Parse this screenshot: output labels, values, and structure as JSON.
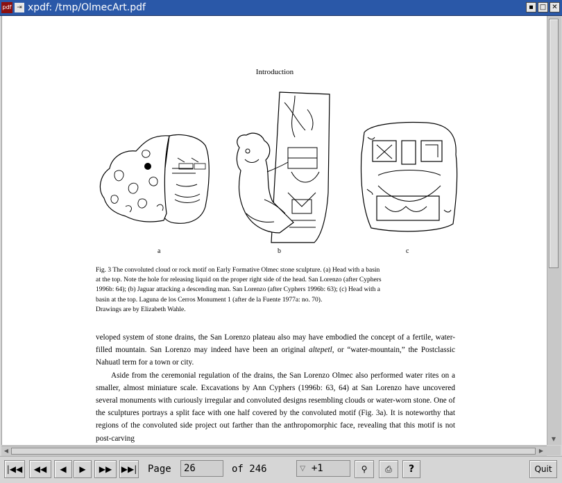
{
  "window": {
    "title": "xpdf: /tmp/OlmecArt.pdf",
    "app_icon_label": "pdf",
    "buttons": [
      "iconify",
      "maximize",
      "close"
    ]
  },
  "document": {
    "running_header": "Introduction",
    "figure_labels": [
      "a",
      "b",
      "c"
    ],
    "caption_lines": [
      "Fig. 3  The convoluted cloud or rock motif on Early Formative Olmec stone sculpture. (a) Head with a basin",
      "at the top. Note the hole for releasing liquid on the proper right side of the head. San Lorenzo (after Cyphers",
      "1996b: 64); (b) Jaguar attacking a descending man. San Lorenzo (after Cyphers 1996b: 63); (c) Head with a",
      "basin at the top. Laguna de los Cerros Monument 1 (after de la Fuente 1977a: no. 70).",
      "Drawings  are by Elizabeth Wahle."
    ],
    "para1_before": "veloped system of stone drains, the San Lorenzo plateau also may have embodied the concept of a fertile, water-filled mountain. San Lorenzo may indeed have been an original ",
    "para1_italic": "altepetl",
    "para1_after": ", or “water-mountain,” the Postclassic Nahuatl term for a town or city.",
    "para2": "Aside from the ceremonial regulation of the drains, the San Lorenzo Olmec also performed water rites on a smaller, almost miniature scale. Excavations by Ann Cyphers (1996b: 63, 64) at San Lorenzo have uncovered several monuments with curiously irregular and convoluted designs resembling clouds or water-worn stone. One of the sculptures portrays a split face with one half covered by the convoluted motif (Fig. 3a). It is noteworthy that regions of the convoluted side project out farther than the anthropomorphic face, revealing that this motif is not post-carving"
  },
  "toolbar": {
    "page_label": "Page",
    "page_value": "26",
    "of_label": "of 246",
    "zoom_value": "+1",
    "quit_label": "Quit",
    "icons": [
      "first-page-icon",
      "back-5-icon",
      "prev-page-icon",
      "next-page-icon",
      "forward-5-icon",
      "last-page-icon",
      "find-icon",
      "print-icon",
      "help-icon"
    ]
  }
}
